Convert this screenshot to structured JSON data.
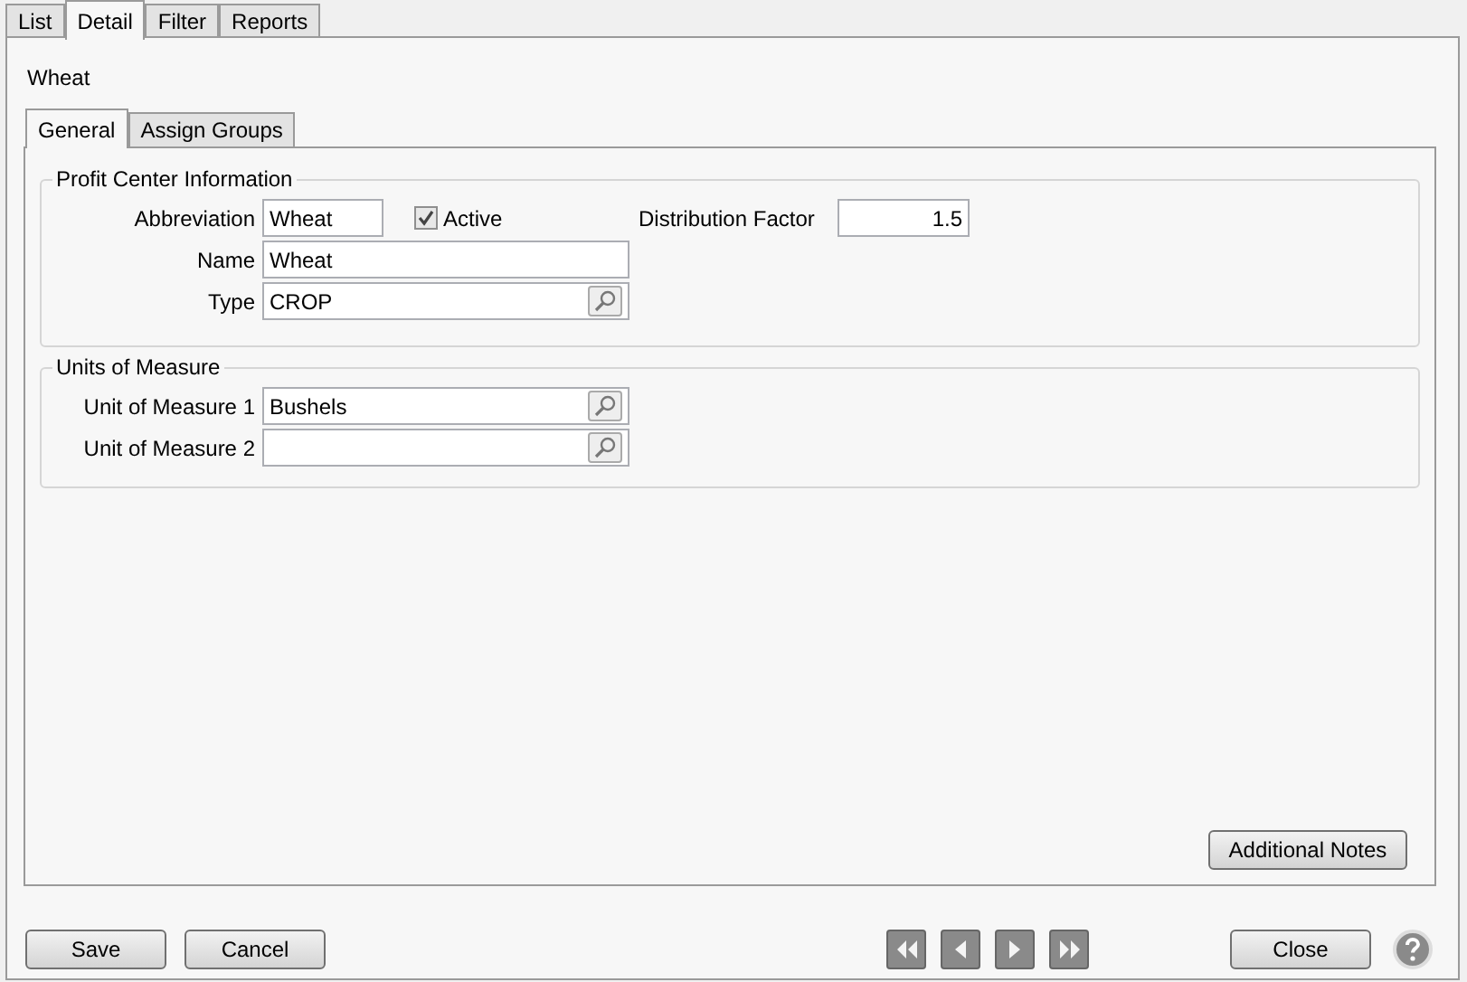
{
  "outer_tabs": [
    {
      "label": "List",
      "selected": false
    },
    {
      "label": "Detail",
      "selected": true
    },
    {
      "label": "Filter",
      "selected": false
    },
    {
      "label": "Reports",
      "selected": false
    }
  ],
  "record_title": "Wheat",
  "inner_tabs": [
    {
      "label": "General",
      "selected": true
    },
    {
      "label": "Assign Groups",
      "selected": false
    }
  ],
  "profit_center": {
    "title": "Profit Center Information",
    "abbreviation": {
      "label": "Abbreviation",
      "value": "Wheat"
    },
    "active": {
      "label": "Active",
      "checked": true
    },
    "distribution_factor": {
      "label": "Distribution Factor",
      "value": "1.5"
    },
    "name": {
      "label": "Name",
      "value": "Wheat"
    },
    "type": {
      "label": "Type",
      "value": "CROP"
    }
  },
  "units_of_measure": {
    "title": "Units of Measure",
    "fields": [
      {
        "label": "Unit of Measure 1",
        "value": "Bushels"
      },
      {
        "label": "Unit of Measure 2"
      }
    ]
  },
  "additional_notes_button": "Additional Notes",
  "buttons": {
    "save": "Save",
    "cancel": "Cancel",
    "close": "Close"
  }
}
